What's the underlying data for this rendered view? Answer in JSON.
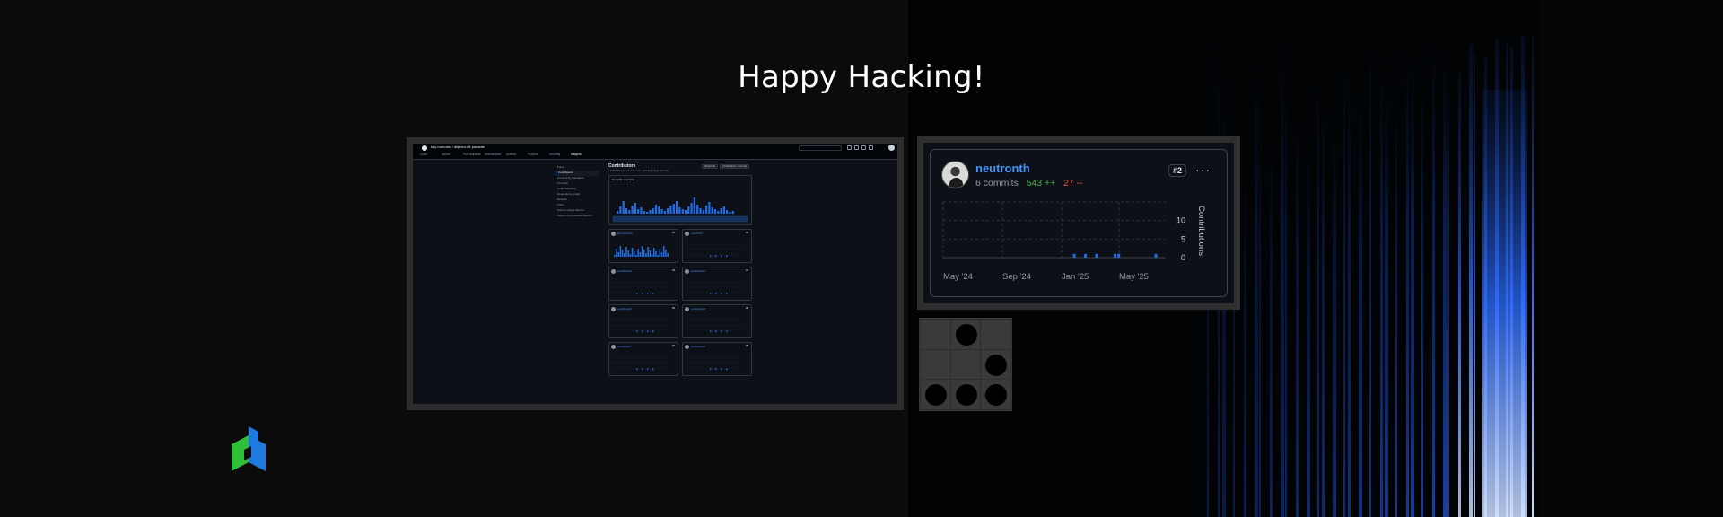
{
  "headline": "Happy Hacking!",
  "github": {
    "repo": "kay-homosis / aligned-dff-parasite",
    "tabs": [
      "Code",
      "Issues",
      "Pull requests",
      "Discussions",
      "Actions",
      "Projects",
      "Security",
      "Insights"
    ],
    "sidebar": [
      "Pulse",
      "Contributors",
      "Community Standards",
      "Commits",
      "Code frequency",
      "Dependency graph",
      "Network",
      "Forks",
      "Actions Usage Metrics",
      "Actions Performance Metrics"
    ],
    "page_title": "Contributors",
    "page_subtitle": "Contributions per week to main, excluding merge commits",
    "period_button": "Period: All",
    "type_button": "Contributions: Commits",
    "card_title": "Commits over time",
    "contributors": [
      {
        "name": "kay-homosis",
        "rank": "#1"
      },
      {
        "name": "neutronth",
        "rank": "#2"
      },
      {
        "name": "contributor3",
        "rank": "#3"
      },
      {
        "name": "contributor4",
        "rank": "#4"
      },
      {
        "name": "contributor5",
        "rank": "#5"
      },
      {
        "name": "contributor6",
        "rank": "#6"
      },
      {
        "name": "contributor7",
        "rank": "#7"
      },
      {
        "name": "contributor8",
        "rank": "#8"
      }
    ]
  },
  "contributor_card": {
    "username": "neutronth",
    "commits": "6 commits",
    "additions": "543 ++",
    "deletions": "27 --",
    "rank": "#2",
    "more_icon": "kebab-horizontal-icon",
    "chart_data": {
      "type": "bar",
      "ylabel": "Contributions",
      "yticks": [
        "0",
        "5",
        "10"
      ],
      "ylim": [
        0,
        15
      ],
      "xticks": [
        "May '24",
        "Sep '24",
        "Jan '25",
        "May '25"
      ],
      "grid": true,
      "series_color": "#1f6feb",
      "values": [
        0,
        0,
        0,
        0,
        0,
        0,
        0,
        0,
        0,
        0,
        0,
        0,
        0,
        0,
        0,
        0,
        0,
        0,
        0,
        0,
        0,
        0,
        0,
        0,
        0,
        0,
        0,
        0,
        0,
        0,
        0,
        0,
        0,
        0,
        0,
        1,
        0,
        0,
        1,
        0,
        0,
        1,
        0,
        0,
        0,
        0,
        1,
        1,
        0,
        0,
        0,
        0,
        0,
        0,
        0,
        0,
        0,
        1,
        0,
        0
      ]
    }
  },
  "glider": {
    "cells": [
      0,
      1,
      0,
      0,
      0,
      1,
      1,
      1,
      1
    ]
  },
  "colors": {
    "accent_blue": "#1f6feb",
    "link_blue": "#4493f8",
    "add_green": "#3fb950",
    "del_red": "#f85149",
    "logo_green": "#2fbf3b",
    "logo_blue": "#1f7ae0"
  }
}
